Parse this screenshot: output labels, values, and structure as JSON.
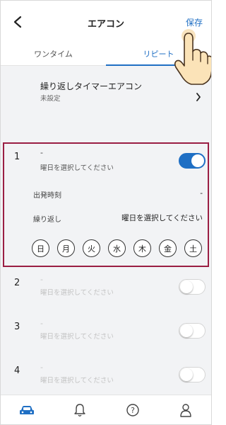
{
  "header": {
    "title": "エアコン",
    "save_label": "保存"
  },
  "tabs": [
    {
      "label": "ワンタイム",
      "active": false
    },
    {
      "label": "リピート",
      "active": true
    }
  ],
  "repeat": {
    "title": "繰り返しタイマーエアコン",
    "subtitle": "未設定"
  },
  "timers": [
    {
      "number": "1",
      "name": "-",
      "hint": "曜日を選択してください",
      "enabled": true,
      "departure_label": "出発時刻",
      "departure_value": "-",
      "repeat_label": "繰り返し",
      "repeat_value": "曜日を選択してください",
      "days": [
        "日",
        "月",
        "火",
        "水",
        "木",
        "金",
        "土"
      ]
    },
    {
      "number": "2",
      "name": "-",
      "hint": "曜日を選択してください",
      "enabled": false
    },
    {
      "number": "3",
      "name": "-",
      "hint": "曜日を選択してください",
      "enabled": false
    },
    {
      "number": "4",
      "name": "-",
      "hint": "曜日を選択してください",
      "enabled": false
    }
  ],
  "nav": [
    "car-icon",
    "bell-icon",
    "help-icon",
    "person-icon"
  ],
  "colors": {
    "accent": "#1f6fc4",
    "highlight_frame": "#9a1e43",
    "background": "#f2f3f5"
  }
}
